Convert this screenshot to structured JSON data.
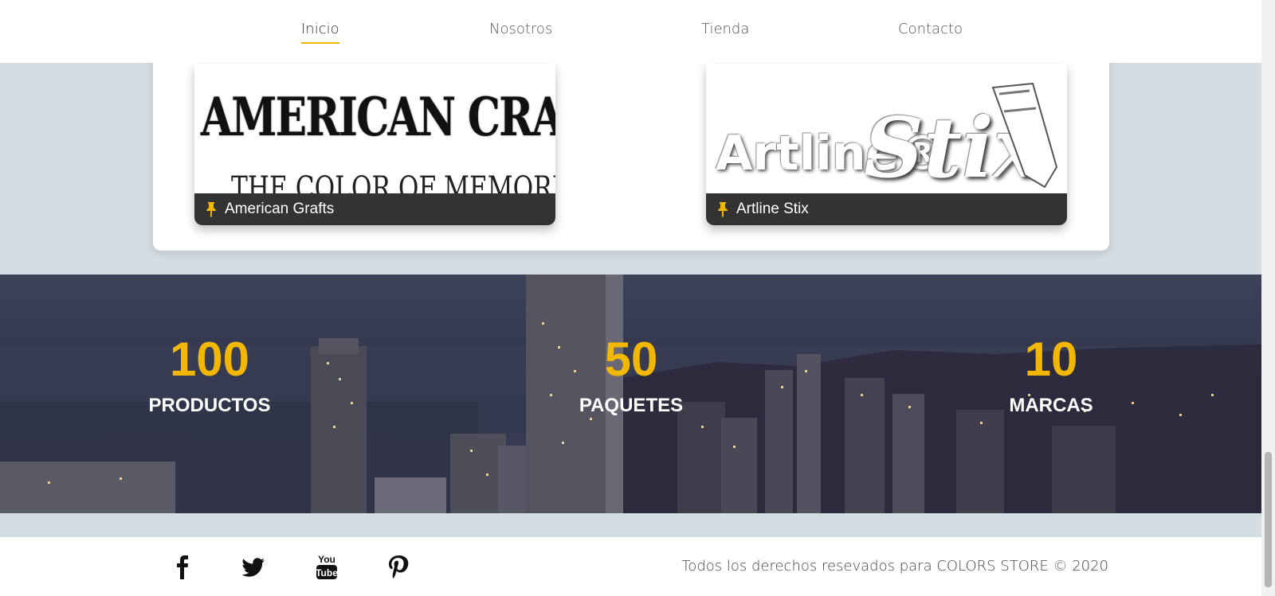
{
  "nav": {
    "items": [
      {
        "label": "Inicio",
        "active": true
      },
      {
        "label": "Nosotros",
        "active": false
      },
      {
        "label": "Tienda",
        "active": false
      },
      {
        "label": "Contacto",
        "active": false
      }
    ],
    "accent_color": "#f2b705"
  },
  "brands": [
    {
      "name": "American Grafts",
      "logo_text_line1": "AMERICAN CRAFTS",
      "logo_text_line2": "THE COLOR OF MEMORIES℠",
      "icon": "pin-icon"
    },
    {
      "name": "Artline Stix",
      "logo_text_line1": "Artline®",
      "logo_text_line2": "Stix",
      "icon": "pin-icon"
    }
  ],
  "stats": [
    {
      "value": "100",
      "label": "PRODUCTOS"
    },
    {
      "value": "50",
      "label": "PAQUETES"
    },
    {
      "value": "10",
      "label": "MARCAS"
    }
  ],
  "footer": {
    "social": [
      "facebook-icon",
      "twitter-icon",
      "youtube-icon",
      "pinterest-icon"
    ],
    "copyright": "Todos los derechos resevados para COLORS STORE © 2020"
  },
  "colors": {
    "accent": "#f2b705",
    "page_bg": "#d5dde3",
    "caption_bg": "#333333"
  }
}
